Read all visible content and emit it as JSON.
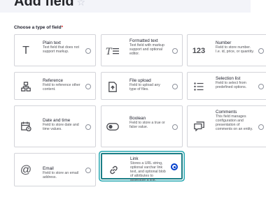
{
  "page": {
    "title": "Add field",
    "star_icon": "star-outline-icon"
  },
  "form": {
    "choose_label": "Choose a type of field",
    "required_marker": "*"
  },
  "field_types": [
    {
      "label": "Plain text",
      "description": "Text field that does not support markup.",
      "icon": "plain-text-icon",
      "selected": false
    },
    {
      "label": "Formatted text",
      "description": "Text field with markup support and optional editor.",
      "icon": "formatted-text-icon",
      "selected": false
    },
    {
      "label": "Number",
      "description": "Field to store number. I.e. id, price, or quantity.",
      "icon": "number-icon",
      "selected": false
    },
    {
      "label": "Reference",
      "description": "Field to reference other content.",
      "icon": "reference-icon",
      "selected": false
    },
    {
      "label": "File upload",
      "description": "Field to upload any type of files.",
      "icon": "file-upload-icon",
      "selected": false
    },
    {
      "label": "Selection list",
      "description": "Field to select from predefined options.",
      "icon": "selection-list-icon",
      "selected": false
    },
    {
      "label": "Date and time",
      "description": "Field to store date and time values.",
      "icon": "calendar-icon",
      "selected": false
    },
    {
      "label": "Boolean",
      "description": "Field to store a true or false value.",
      "icon": "toggle-icon",
      "selected": false
    },
    {
      "label": "Comments",
      "description": "This field manages configuration and presentation of comments on an entity.",
      "icon": "comments-icon",
      "selected": false
    },
    {
      "label": "Email",
      "description": "Field to store an email address.",
      "icon": "at-sign-icon",
      "selected": false
    },
    {
      "label": "Link",
      "description": "Stores a URL string, optional varchar link text, and optional blob of attributes to assemble a link.",
      "icon": "link-icon",
      "selected": true
    }
  ],
  "number_icon_text": "123",
  "plain_text_icon_text": "T",
  "at_icon_text": "@",
  "colors": {
    "selected_border": "#1b7e86",
    "radio_checked": "#003ecc",
    "required": "#d72222"
  }
}
